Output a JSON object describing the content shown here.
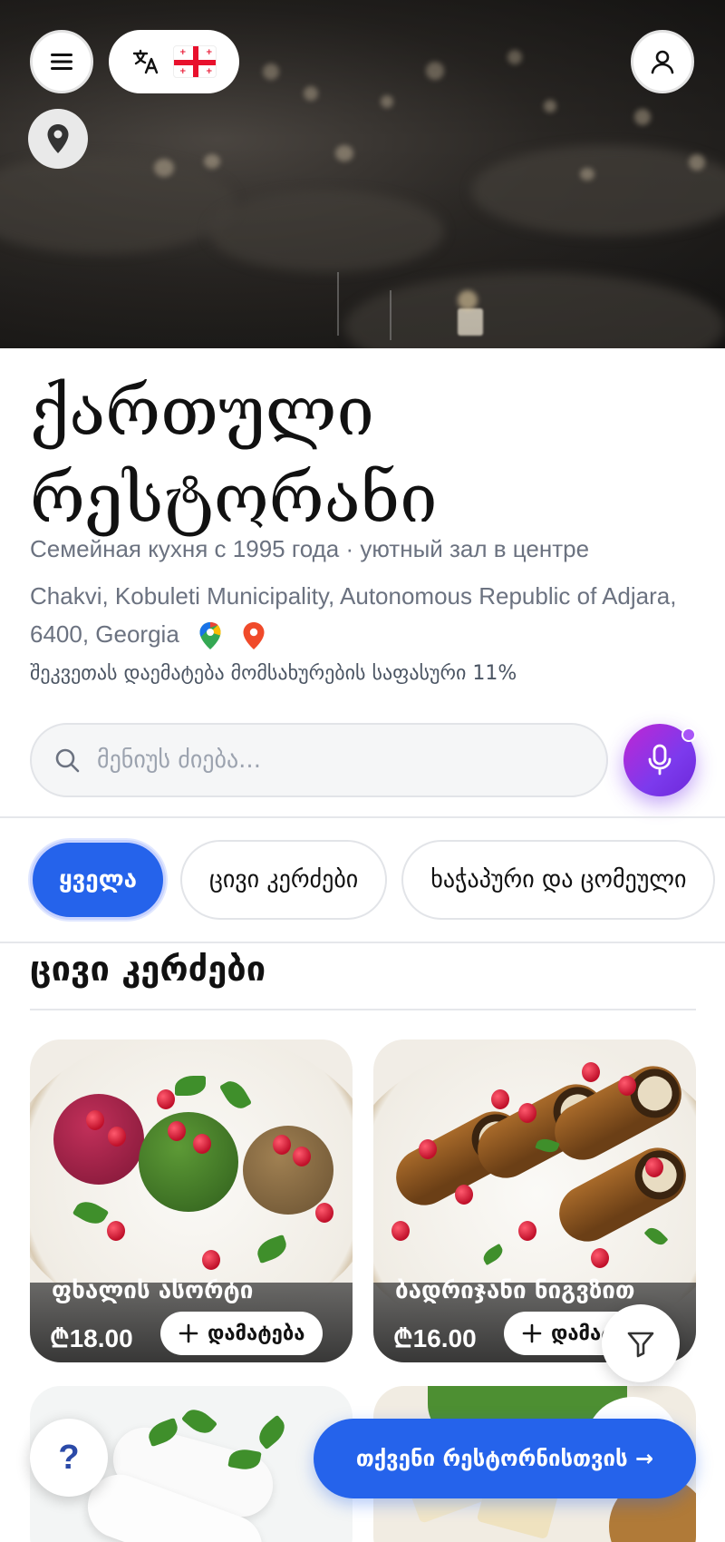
{
  "header": {
    "menu_icon": "hamburger-menu-icon",
    "language_icon": "translate-icon",
    "flag": "georgia-flag",
    "profile_icon": "user-icon",
    "location_icon": "map-pin-icon"
  },
  "restaurant": {
    "title_line1": "ქართული",
    "title_line2": "რესტორანი",
    "subtitle": "Семейная кухня с 1995 года · уютный зал в центре",
    "address": "Chakvi, Kobuleti Municipality, Autonomous Republic of Adjara, 6400, Georgia",
    "service_fee_note": "შეკვეთას დაემატება მომსახურების საფასური 11%"
  },
  "search": {
    "placeholder": "მენიუს ძიება..."
  },
  "categories": [
    {
      "label": "ყველა",
      "active": true
    },
    {
      "label": "ცივი კერძები",
      "active": false
    },
    {
      "label": "ხაჭაპური და ცომეული",
      "active": false
    }
  ],
  "section": {
    "title": "ცივი კერძები"
  },
  "items": [
    {
      "name": "ფხალის ასორტი",
      "price": "₾18.00",
      "add_label": "დამატება"
    },
    {
      "name": "ბადრიჯანი ნიგვზით",
      "price": "₾16.00",
      "add_label": "დამატება"
    }
  ],
  "floating": {
    "help_label": "?",
    "cta_label": "თქვენი რესტორნისთვის →"
  },
  "colors": {
    "accent": "#2563eb",
    "mic_gradient_start": "#c026d3",
    "mic_gradient_end": "#6d28d9"
  }
}
